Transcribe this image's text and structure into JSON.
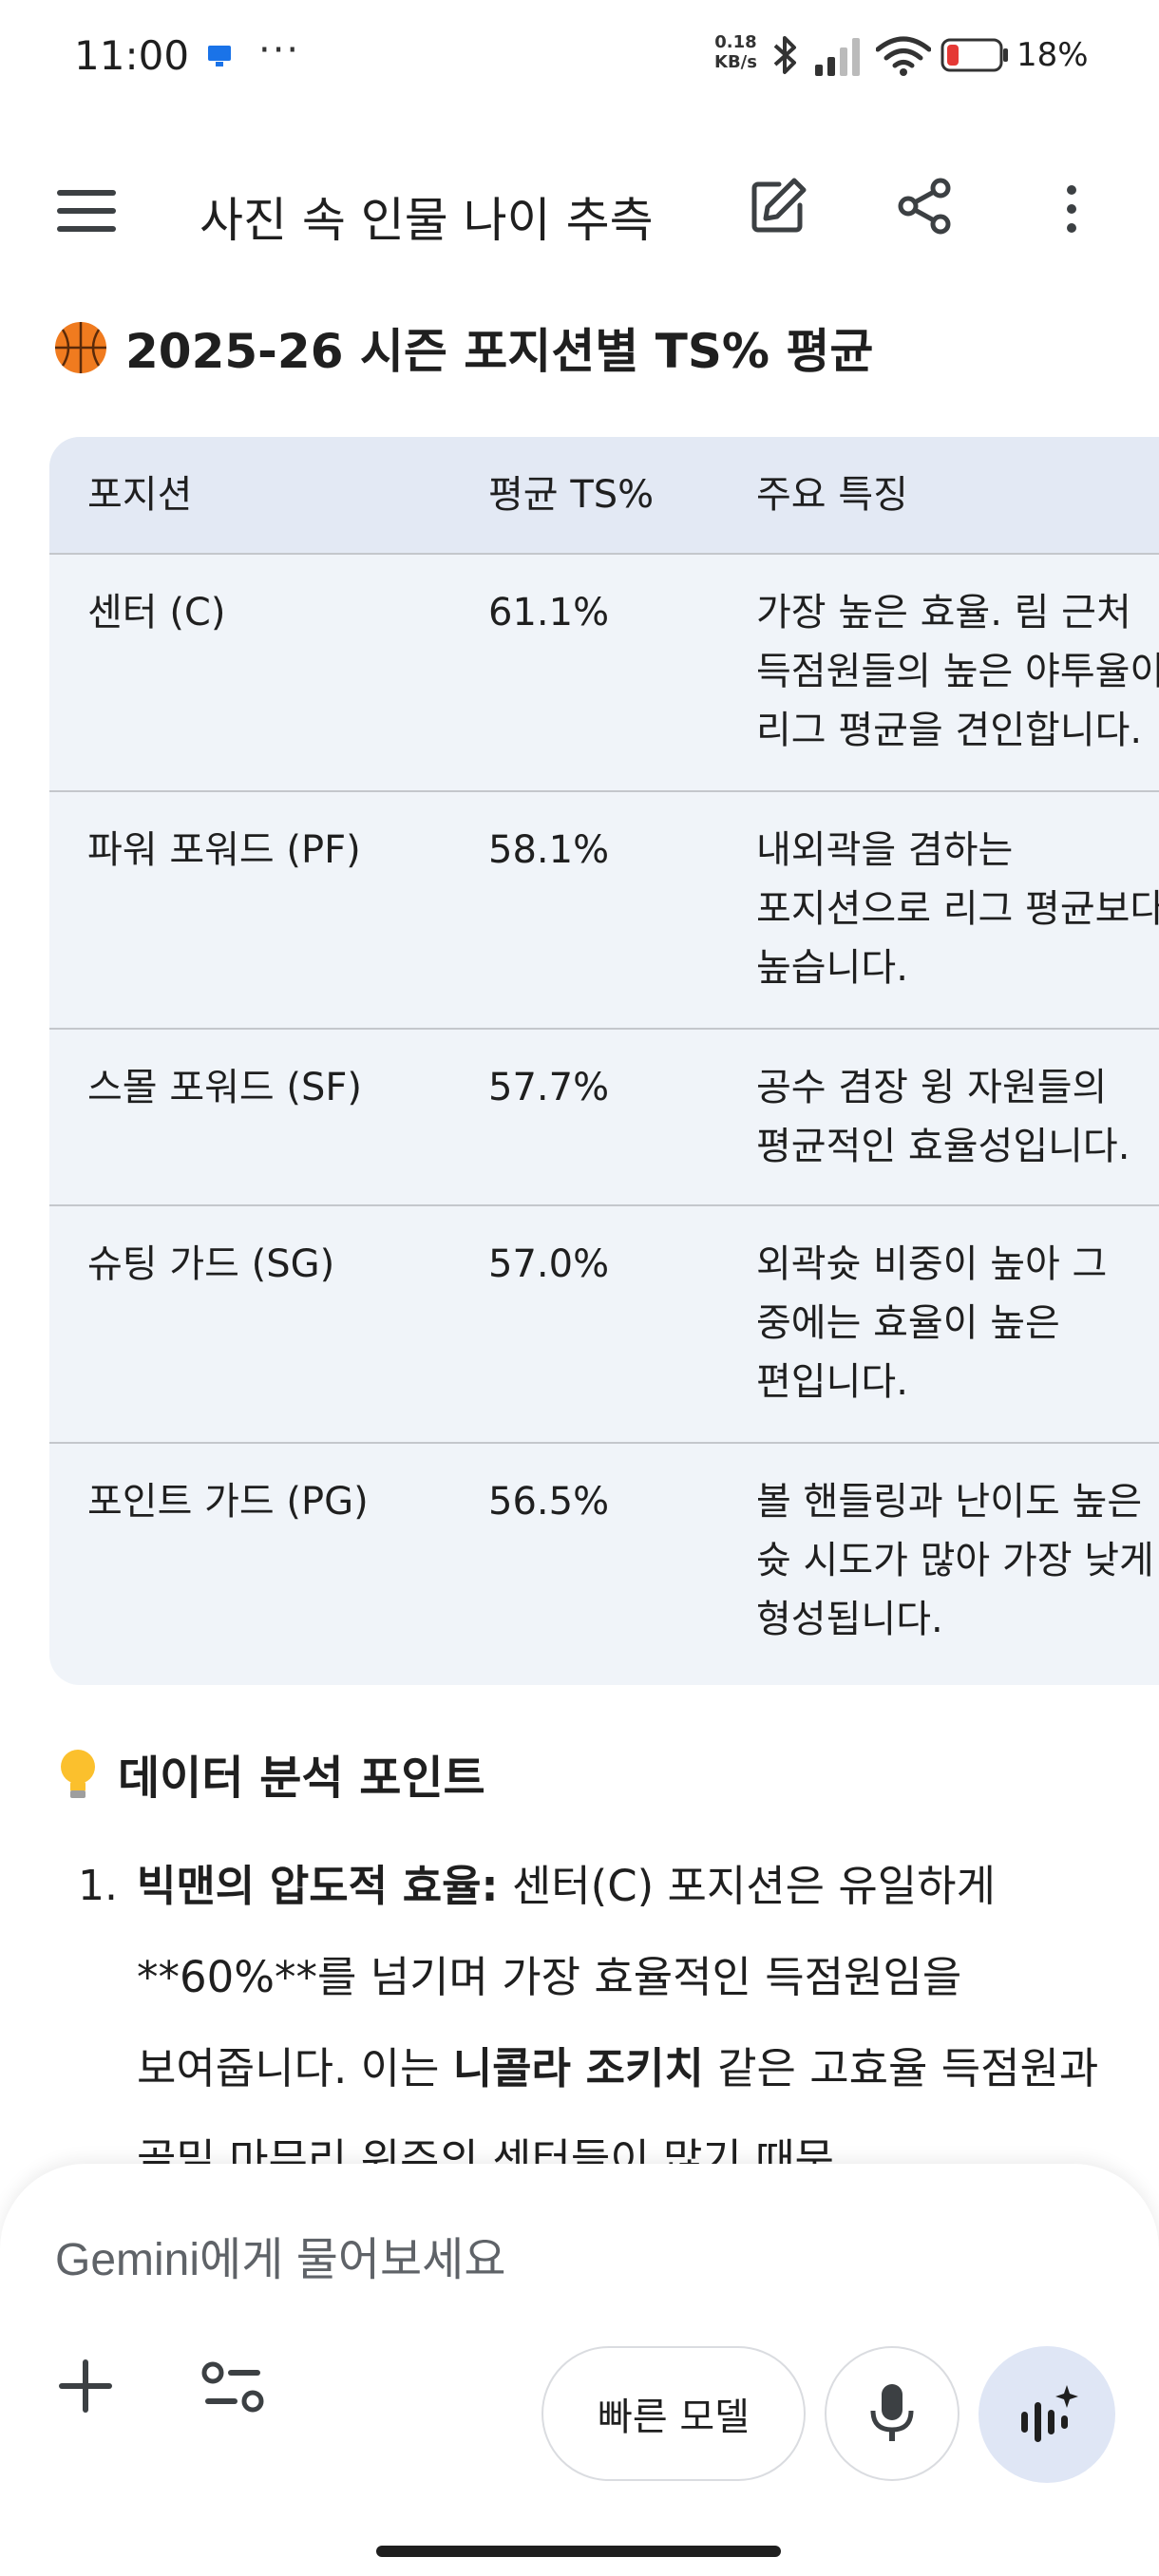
{
  "status_bar": {
    "time": "11:00",
    "dots": "···",
    "speed_value": "0.18",
    "speed_unit": "KB/s",
    "battery": "18%"
  },
  "app_bar": {
    "title": "사진 속 인물 나이 추측"
  },
  "section": {
    "heading": "2025-26 시즌 포지션별 TS% 평균"
  },
  "table": {
    "headers": [
      "포지션",
      "평균 TS%",
      "주요 특징"
    ],
    "rows": [
      {
        "position": "센터 (C)",
        "ts": "61.1%",
        "feature": "가장 높은 효율. 림 근처 득점원들의 높은 야투율이 리그 평균을 견인합니다."
      },
      {
        "position": "파워 포워드 (PF)",
        "ts": "58.1%",
        "feature": "내외곽을 겸하는 포지션으로 리그 평균보다 높습니다."
      },
      {
        "position": "스몰 포워드 (SF)",
        "ts": "57.7%",
        "feature": "공수 겸장 윙 자원들의 평균적인 효율성입니다."
      },
      {
        "position": "슈팅 가드 (SG)",
        "ts": "57.0%",
        "feature": "외곽슛 비중이 높아 그 중에는 효율이 높은 편입니다."
      },
      {
        "position": "포인트 가드 (PG)",
        "ts": "56.5%",
        "feature": "볼 핸들링과 난이도 높은 슛 시도가 많아 가장 낮게 형성됩니다."
      }
    ]
  },
  "analysis": {
    "heading": "데이터 분석 포인트",
    "points": [
      {
        "num": "1.",
        "bold_title": "빅맨의 압도적 효율:",
        "text_a": " 센터(C) 포지션은 유일하게 **60%**를 넘기며 가장 효율적인 득점원임을 보여줍니다. 이는 ",
        "bold_name": "니콜라 조키치",
        "text_b": " 같은 고효율 득점원과 골밑 마무리 위주의 센터들이 많기 때문"
      }
    ]
  },
  "composer": {
    "placeholder": "Gemini에게 물어보세요",
    "model_label": "빠른 모델"
  },
  "icons": {
    "menu": "menu-icon",
    "edit": "edit-icon",
    "share": "share-icon",
    "more": "more-vert-icon",
    "plus": "plus-icon",
    "tools": "tools-icon",
    "mic": "mic-icon",
    "live": "live-audio-icon"
  },
  "colors": {
    "table_header_bg": "#e3e9f4",
    "table_body_bg": "#f0f4f9",
    "live_button_bg": "#dfe6f5",
    "battery_low": "#e53935"
  }
}
